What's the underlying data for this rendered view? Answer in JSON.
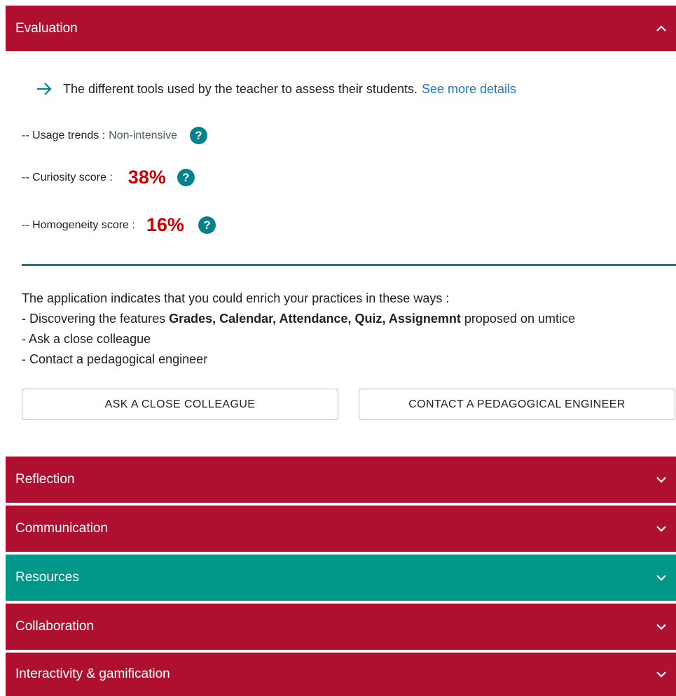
{
  "colors": {
    "crimson": "#b01030",
    "teal": "#009688",
    "accent_teal": "#00838f",
    "score_red": "#d00000",
    "link_blue": "#1976d2"
  },
  "evaluation": {
    "title": "Evaluation",
    "icon": "chevron-up-icon",
    "intro_text": "The different tools used by the teacher to assess their students.",
    "intro_link": "See more details",
    "usage_label": "-- Usage trends :",
    "usage_value": "Non-intensive",
    "curiosity_label": "-- Curiosity score :",
    "curiosity_value": "38%",
    "homogeneity_label": "-- Homogeneity score :",
    "homogeneity_value": "16%",
    "help_glyph": "?",
    "advice_intro": "The application indicates that you could enrich your practices in these ways :",
    "advice_1_prefix": "- Discovering the features ",
    "advice_1_bold": "Grades, Calendar, Attendance, Quiz, Assignemnt",
    "advice_1_suffix": " proposed on umtice",
    "advice_2": "- Ask a close colleague",
    "advice_3": "- Contact a pedagogical engineer",
    "button_colleague": "ASK A CLOSE COLLEAGUE",
    "button_engineer": "CONTACT A PEDAGOGICAL ENGINEER"
  },
  "sections": [
    {
      "title": "Reflection",
      "icon": "chevron-down-icon"
    },
    {
      "title": "Communication",
      "icon": "chevron-down-icon"
    },
    {
      "title": "Resources",
      "icon": "chevron-down-icon"
    },
    {
      "title": "Collaboration",
      "icon": "chevron-down-icon"
    },
    {
      "title": "Interactivity & gamification",
      "icon": "chevron-down-icon"
    }
  ]
}
